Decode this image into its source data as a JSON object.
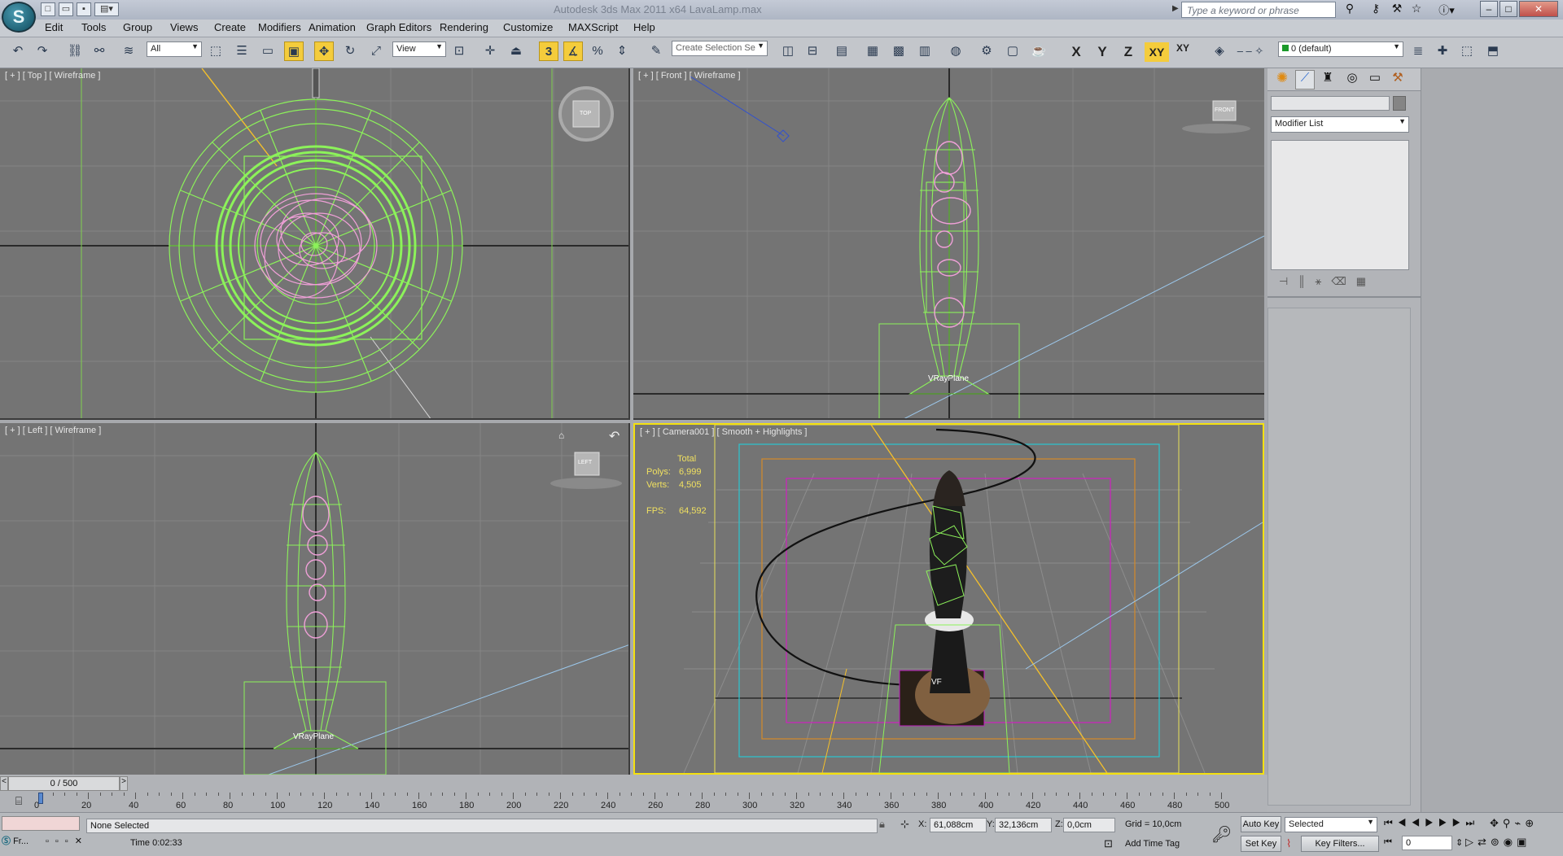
{
  "app": {
    "title": "Autodesk 3ds Max  2011 x64      LavaLamp.max",
    "logo": "S"
  },
  "search": {
    "placeholder": "Type a keyword or phrase"
  },
  "menu": [
    "Edit",
    "Tools",
    "Group",
    "Views",
    "Create",
    "Modifiers",
    "Animation",
    "Graph Editors",
    "Rendering",
    "Customize",
    "MAXScript",
    "Help"
  ],
  "toolbar": {
    "filter": "All",
    "ref_coord": "View",
    "snap_label": "3",
    "selection_set": "Create Selection Se",
    "axes": [
      "X",
      "Y",
      "Z",
      "XY"
    ],
    "axis_extra": "XY",
    "layer": "0 (default)"
  },
  "viewports": {
    "top": {
      "label": "[ + ] [ Top ] [ Wireframe ]",
      "cube": "TOP"
    },
    "front": {
      "label": "[ + ] [ Front ] [ Wireframe ]",
      "cube": "FRONT",
      "tag": "VRayPlane"
    },
    "left": {
      "label": "[ + ] [ Left ] [ Wireframe ]",
      "cube": "LEFT",
      "tag": "VRayPlane"
    },
    "camera": {
      "label": "[ + ] [ Camera001 ] [ Smooth + Highlights ]",
      "stats": {
        "header": "Total",
        "polys_label": "Polys:",
        "polys": "6,999",
        "verts_label": "Verts:",
        "verts": "4,505",
        "fps_label": "FPS:",
        "fps": "64,592"
      },
      "tag": "VF"
    }
  },
  "command_panel": {
    "modifier_list": "Modifier List"
  },
  "timeline": {
    "frame": "0 / 500",
    "ticks": [
      "0",
      "20",
      "40",
      "60",
      "80",
      "100",
      "120",
      "140",
      "160",
      "180",
      "200",
      "220",
      "240",
      "260",
      "280",
      "300",
      "320",
      "340",
      "360",
      "380",
      "400",
      "420",
      "440",
      "460",
      "480",
      "500"
    ]
  },
  "status": {
    "selection": "None Selected",
    "time": "Time  0:02:33",
    "x_label": "X:",
    "x": "61,088cm",
    "y_label": "Y:",
    "y": "32,136cm",
    "z_label": "Z:",
    "z": "0,0cm",
    "grid": "Grid = 10,0cm",
    "add_time_tag": "Add Time Tag",
    "auto_key": "Auto Key",
    "set_key": "Set Key",
    "key_mode": "Selected",
    "key_filters": "Key Filters...",
    "frame_field": "0",
    "listener": "Fr..."
  },
  "colors": {
    "wire": "#8cf25a",
    "pink": "#f0a0d8",
    "active_border": "#f4e010",
    "viewport_bg": "#747474"
  }
}
